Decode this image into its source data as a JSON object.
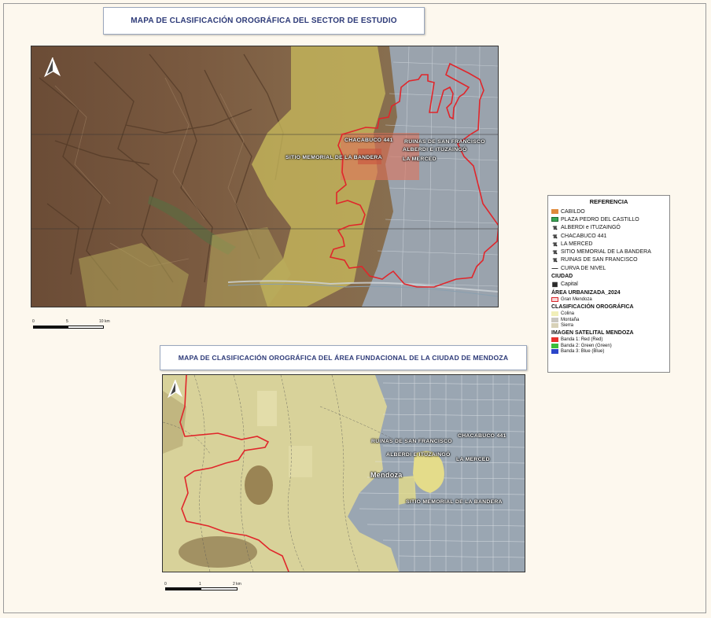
{
  "map1": {
    "title": "MAPA DE CLASIFICACIÓN OROGRÁFICA DEL SECTOR DE ESTUDIO",
    "labels": {
      "chacabuco": "CHACABUCO 441",
      "ruinas": "RUINAS DE SAN FRANCISCO",
      "alberdi": "ALBERDI E ITUZAINGÓ",
      "sitio": "SITIO MEMORIAL DE LA BANDERA",
      "merced": "LA MERCED"
    },
    "scale": {
      "s0": "0",
      "s1": "5",
      "s2": "10 km"
    }
  },
  "map2": {
    "title": "MAPA DE CLASIFICACIÓN OROGRÁFICA DEL ÁREA FUNDACIONAL DE LA CIUDAD DE MENDOZA",
    "labels": {
      "ruinas": "RUINAS DE SAN FRANCISCO",
      "chacabuco": "CHACABUCO 441",
      "alberdi": "ALBERDI E ITUZAINGÓ",
      "merced": "LA MERCED",
      "mendoza": "Mendoza",
      "sitio": "SITIO MEMORIAL DE LA BANDERA"
    },
    "scale": {
      "s0": "0",
      "s1": "1",
      "s2": "2 km"
    }
  },
  "legend": {
    "title": "REFERENCIA",
    "items": {
      "cabildo": "CABILDO",
      "plaza": "PLAZA PEDRO DEL CASTILLO",
      "alberdi": "ALBERDI e ITUZAINGÓ",
      "chacabuco": "CHACABUCO 441",
      "merced": "LA MERCED",
      "sitio": "SITIO MEMORIAL DE LA BANDERA",
      "ruinas": "RUINAS DE SAN FRANCISCO",
      "curva": "CURVA DE NIVEL"
    },
    "ciudad_header": "CIUDAD",
    "ciudad_item": "Capital",
    "area_header": "ÁREA URBANIZADA_2024",
    "area_item": "Gran Mendoza",
    "clasif_header": "CLASIFICACIÓN OROGRÁFICA",
    "clasif_items": {
      "colina": "Colina",
      "montana": "Montaña",
      "sierra": "Sierra"
    },
    "imagen_header": "IMAGEN SATELITAL MENDOZA",
    "bandas": {
      "b1": "Banda 1: Red (Red)",
      "b2": "Banda 2: Green (Green)",
      "b3": "Banda 3: Blue (Blue)"
    },
    "colors": {
      "cabildo": "#e08a3c",
      "plaza": "#3aa655",
      "area_outline": "#d9262b",
      "colina": "#f1efb8",
      "montana": "#c9c7c0",
      "sierra": "#d8d2b8",
      "band_red": "#e8322d",
      "band_green": "#3bbf3b",
      "band_blue": "#2b45c9"
    }
  }
}
